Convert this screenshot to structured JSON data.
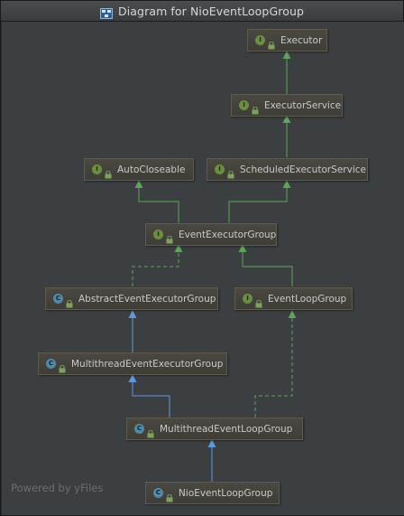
{
  "window": {
    "title": "Diagram for NioEventLoopGroup"
  },
  "watermark": "Powered by yFiles",
  "colors": {
    "canvas": "#3c3f41",
    "node_fill": "#46443d",
    "node_border": "#5f5b4d",
    "extends_arrow": "#5b9ae0",
    "implements_arrow": "#5da55a",
    "interface_badge": "#6a8f3d",
    "class_badge": "#4f8aa8"
  },
  "nodes": {
    "executor": {
      "label": "Executor",
      "badge": "I",
      "kind": "interface"
    },
    "executor_service": {
      "label": "ExecutorService",
      "badge": "I",
      "kind": "interface"
    },
    "auto_closeable": {
      "label": "AutoCloseable",
      "badge": "I",
      "kind": "interface"
    },
    "scheduled_executor_service": {
      "label": "ScheduledExecutorService",
      "badge": "I",
      "kind": "interface"
    },
    "event_executor_group": {
      "label": "EventExecutorGroup",
      "badge": "I",
      "kind": "interface"
    },
    "abstract_event_executor_group": {
      "label": "AbstractEventExecutorGroup",
      "badge": "C",
      "kind": "abstract"
    },
    "event_loop_group": {
      "label": "EventLoopGroup",
      "badge": "I",
      "kind": "interface"
    },
    "multithread_event_executor_group": {
      "label": "MultithreadEventExecutorGroup",
      "badge": "C",
      "kind": "abstract"
    },
    "multithread_event_loop_group": {
      "label": "MultithreadEventLoopGroup",
      "badge": "C",
      "kind": "abstract"
    },
    "nio_event_loop_group": {
      "label": "NioEventLoopGroup",
      "badge": "C",
      "kind": "class"
    }
  }
}
